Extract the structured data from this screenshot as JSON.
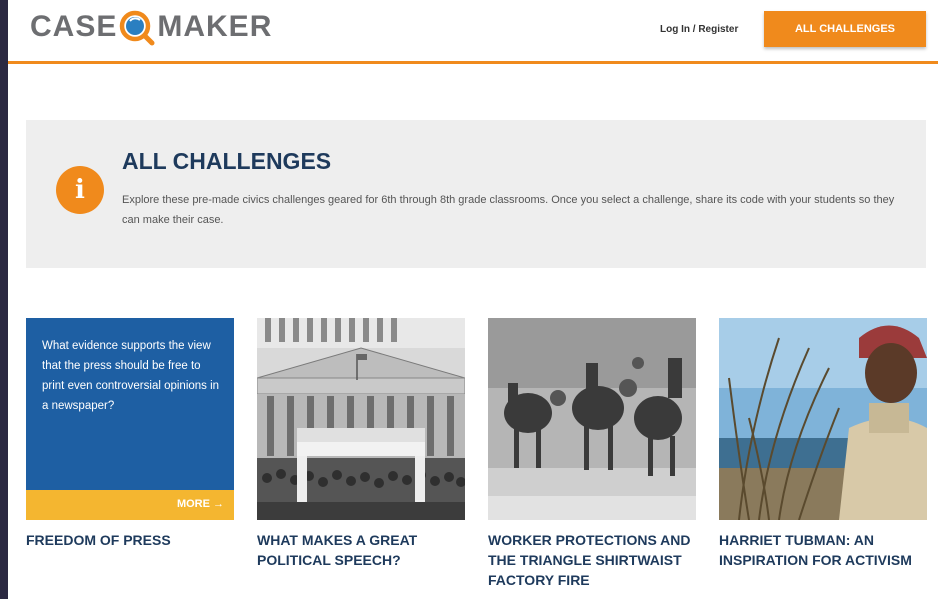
{
  "header": {
    "logo_left": "CASE",
    "logo_right": "MAKER",
    "login_label": "Log In / Register",
    "all_challenges_button": "ALL CHALLENGES"
  },
  "info": {
    "title": "ALL CHALLENGES",
    "description": "Explore these pre-made civics challenges geared for 6th through 8th grade classrooms. Once you select a challenge, share its code with your students so they can make their case."
  },
  "cards": [
    {
      "question": "What evidence supports the view that the press should be free to print even controversial opinions in a newspaper?",
      "more_label": "MORE →",
      "title": "FREEDOM OF PRESS"
    },
    {
      "title": "WHAT MAKES A GREAT POLITICAL SPEECH?"
    },
    {
      "title": "WORKER PROTECTIONS AND THE TRIANGLE SHIRTWAIST FACTORY FIRE"
    },
    {
      "title": "HARRIET TUBMAN: AN INSPIRATION FOR ACTIVISM"
    }
  ],
  "colors": {
    "accent": "#f08a1c",
    "title_navy": "#1e3a5c",
    "card_blue": "#1e5fa3",
    "card_yellow": "#f4b630"
  }
}
